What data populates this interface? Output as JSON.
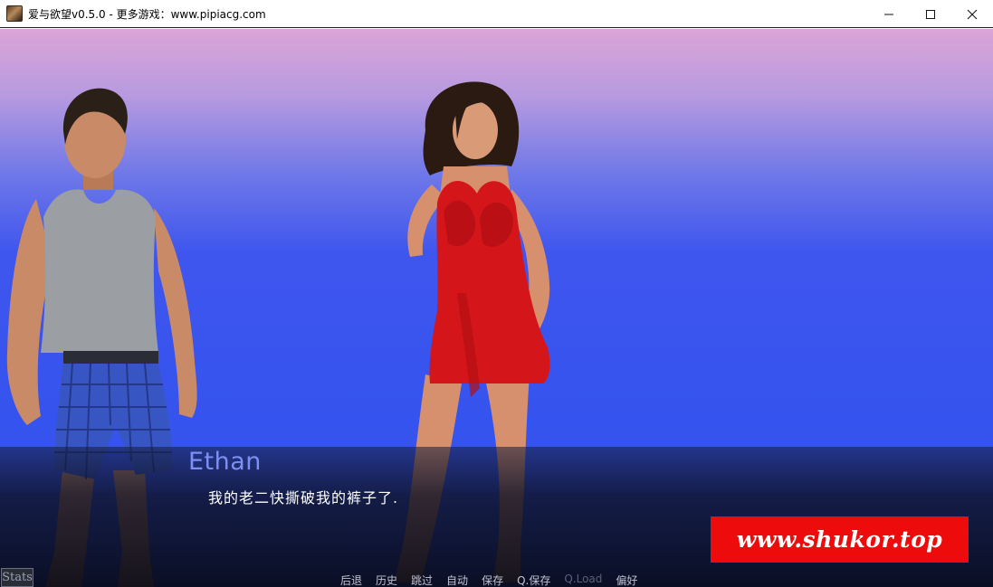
{
  "window": {
    "title": "爱与欲望v0.5.0 - 更多游戏：www.pipiacg.com",
    "controls": [
      "minimize-icon",
      "maximize-icon",
      "close-icon"
    ]
  },
  "scene": {
    "background_top": "#dba4d6",
    "background_bottom": "#3553ee"
  },
  "dialogue": {
    "speaker": "Ethan",
    "speaker_color": "#7d8ff0",
    "text": "我的老二快撕破我的裤子了."
  },
  "quick_menu": {
    "items": [
      {
        "label": "后退",
        "enabled": true
      },
      {
        "label": "历史",
        "enabled": true
      },
      {
        "label": "跳过",
        "enabled": true
      },
      {
        "label": "自动",
        "enabled": true
      },
      {
        "label": "保存",
        "enabled": true
      },
      {
        "label": "Q.保存",
        "enabled": true
      },
      {
        "label": "Q.Load",
        "enabled": false
      },
      {
        "label": "偏好",
        "enabled": true
      }
    ]
  },
  "stats_button": {
    "label": "Stats"
  },
  "watermark": {
    "text": "www.shukor.top",
    "color": "#ee0b0b"
  }
}
